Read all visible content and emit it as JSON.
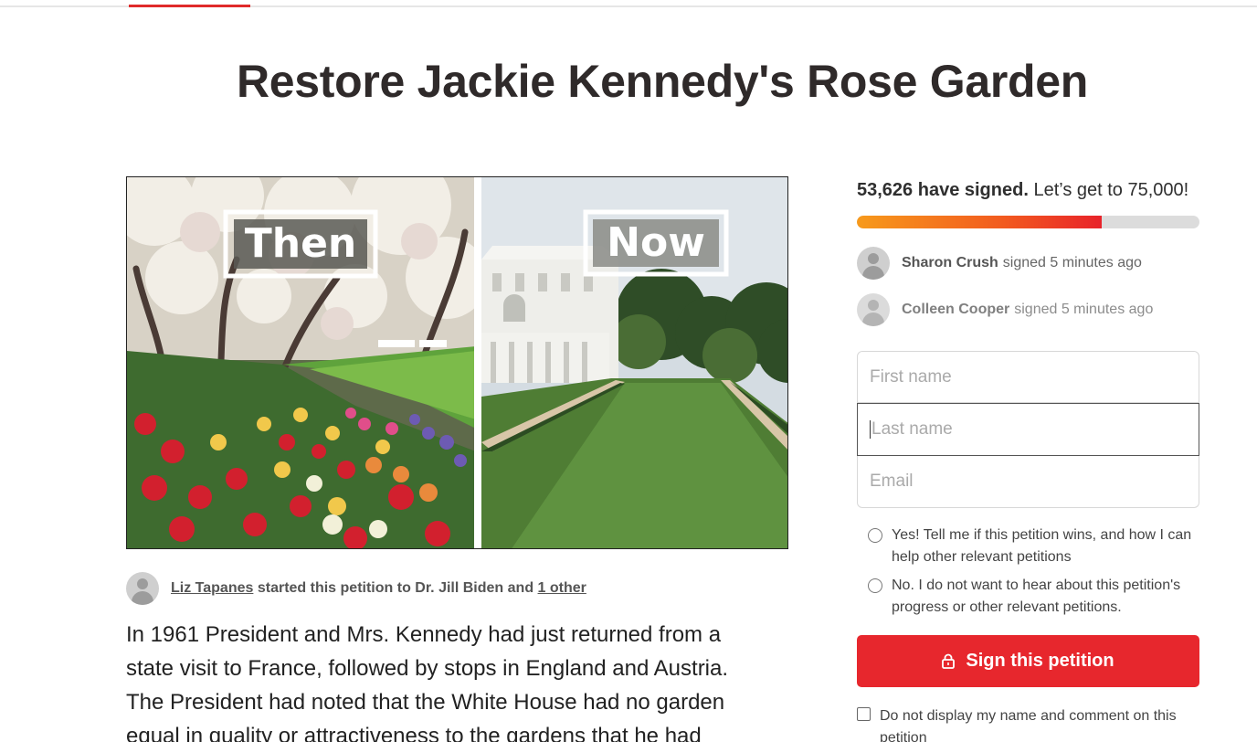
{
  "page": {
    "title": "Restore Jackie Kennedy's Rose Garden"
  },
  "hero": {
    "label_then": "Then",
    "label_now": "Now"
  },
  "author": {
    "name": "Liz Tapanes",
    "middle": " started this petition to Dr. Jill Biden and ",
    "other": "1 other"
  },
  "body": {
    "text": "In 1961 President and Mrs. Kennedy had just returned from a state visit to France, followed by stops in England and Austria. The President had noted that the White House had no garden equal in quality or attractiveness to the gardens that he had"
  },
  "progress": {
    "signed_count": "53,626 have signed.",
    "goal_text": " Let’s get to 75,000!",
    "signed": 53626,
    "goal": 75000
  },
  "recent_signers": [
    {
      "name": "Sharon Crush",
      "action": "signed 5 minutes ago"
    },
    {
      "name": "Colleen Cooper",
      "action": "signed 5 minutes ago"
    }
  ],
  "form": {
    "first_name_placeholder": "First name",
    "last_name_placeholder": "Last name",
    "email_placeholder": "Email",
    "opt_in_yes": "Yes! Tell me if this petition wins, and how I can help other relevant petitions",
    "opt_in_no": "No. I do not want to hear about this petition's progress or other relevant petitions.",
    "sign_button": "Sign this petition",
    "hide_name_label": "Do not display my name and comment on this petition"
  },
  "colors": {
    "accent": "#e7272d",
    "progress_start": "#f79a1c",
    "progress_end": "#e8232a"
  },
  "icons": {
    "sign_button_icon": "lock-icon",
    "avatar_icon": "user-avatar-icon"
  }
}
